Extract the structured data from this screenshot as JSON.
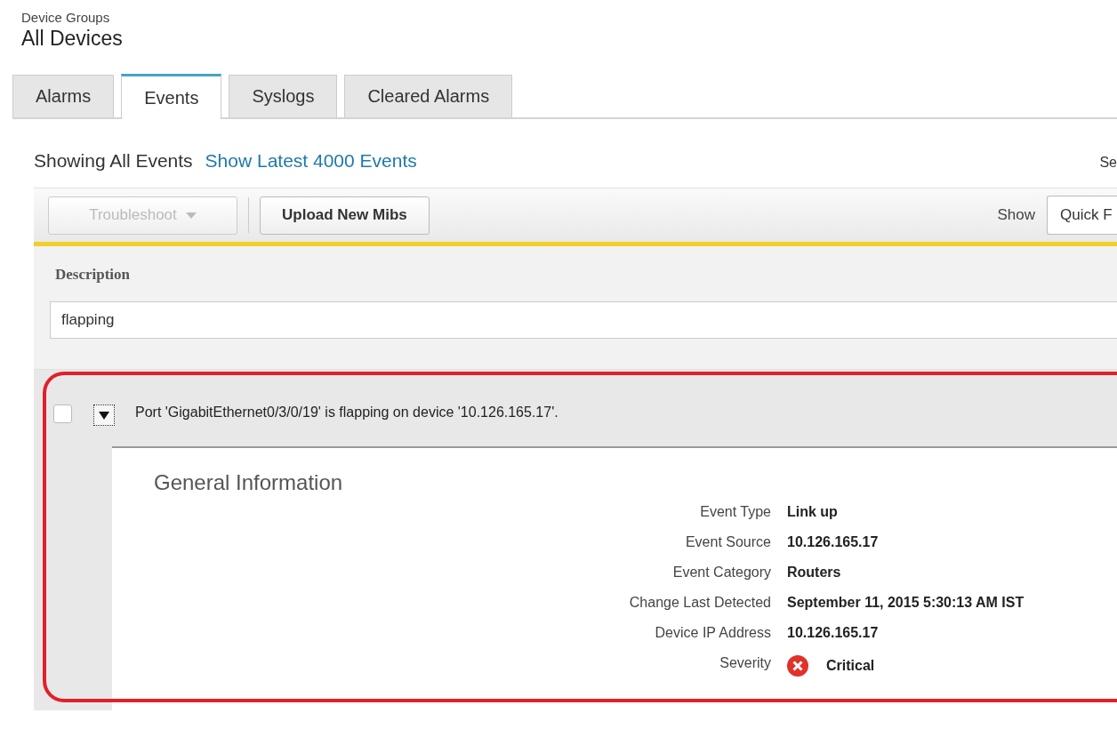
{
  "breadcrumb": {
    "parent": "Device Groups",
    "title": "All Devices"
  },
  "tabs": [
    {
      "label": "Alarms",
      "selected": false
    },
    {
      "label": "Events",
      "selected": true
    },
    {
      "label": "Syslogs",
      "selected": false
    },
    {
      "label": "Cleared Alarms",
      "selected": false
    }
  ],
  "summary": {
    "text": "Showing All Events",
    "link": "Show Latest 4000 Events",
    "search_label": "Se"
  },
  "toolbar": {
    "buttons": [
      {
        "label": "Troubleshoot",
        "disabled": true,
        "dropdown": true
      },
      {
        "label": "Upload New Mibs",
        "disabled": false,
        "dropdown": false
      }
    ],
    "show_label": "Show",
    "show_value": "Quick F"
  },
  "filter": {
    "label": "Description",
    "value": "flapping"
  },
  "events": [
    {
      "description": "Port 'GigabitEthernet0/3/0/19' is flapping on device '10.126.165.17'.",
      "checked": false,
      "expanded": true,
      "highlighted": true,
      "details": {
        "title": "General Information",
        "fields": [
          {
            "label": "Event Type",
            "value": "Link up",
            "kind": "text"
          },
          {
            "label": "Event Source",
            "value": "10.126.165.17",
            "kind": "text"
          },
          {
            "label": "Event Category",
            "value": "Routers",
            "kind": "text"
          },
          {
            "label": "Change Last Detected",
            "value": "September 11, 2015 5:30:13 AM IST",
            "kind": "text"
          },
          {
            "label": "Device IP Address",
            "value": "10.126.165.17",
            "kind": "text"
          },
          {
            "label": "Severity",
            "value": "Critical",
            "kind": "severity"
          }
        ]
      }
    }
  ]
}
